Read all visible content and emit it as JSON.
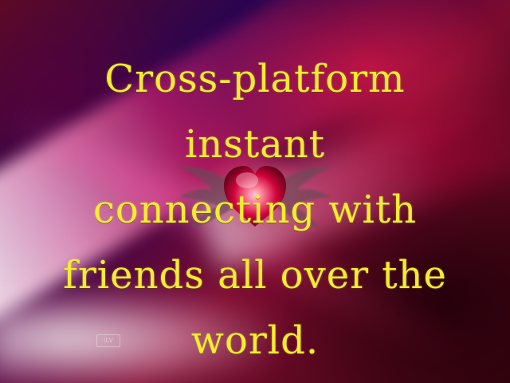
{
  "slide": {
    "lines": [
      "Cross-platform",
      "instant",
      "connecting with",
      "friends all over the",
      "world."
    ],
    "watermark": "ILV"
  },
  "colors": {
    "text": "#f3ec32",
    "background_primary": "#7b0b2f",
    "background_secondary": "#2a0450",
    "glow": "#ff2d7a"
  },
  "icons": {
    "center_emblem": "winged-heart-icon"
  }
}
